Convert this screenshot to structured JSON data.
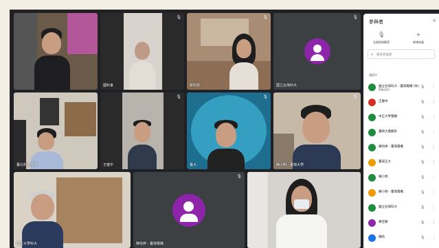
{
  "tiles": [
    {
      "name": "",
      "kind": "video"
    },
    {
      "name": "國科會",
      "kind": "video"
    },
    {
      "name": "新科技",
      "kind": "video"
    },
    {
      "name": "國立台灣科大",
      "kind": "avatar"
    },
    {
      "name": "臺北科技大學",
      "kind": "video"
    },
    {
      "name": "王健中",
      "kind": "video"
    },
    {
      "name": "臺大",
      "kind": "video"
    },
    {
      "name": "陳小明 - 臺灣大學",
      "kind": "video"
    },
    {
      "name": "國立大學科大",
      "kind": "video"
    },
    {
      "name": "陳怡婷 - 臺灣電機",
      "kind": "avatar"
    },
    {
      "name": "",
      "kind": "video"
    }
  ],
  "panel": {
    "title": "參與者",
    "close": "×",
    "actions": [
      {
        "icon": "mic-off-icon",
        "glyph": "🎙",
        "label": "全部設為靜音"
      },
      {
        "icon": "add-person-icon",
        "glyph": "+",
        "label": "新增成員"
      }
    ],
    "search_placeholder": "搜尋參與者",
    "section": "通話中",
    "participants": [
      {
        "name": "國立台灣科大 - 臺灣電機 (你)",
        "sub": "會議主辦人",
        "color": "#1e8e3e"
      },
      {
        "name": "王健中",
        "sub": "",
        "color": "#d93025"
      },
      {
        "name": "中正大學電機",
        "sub": "",
        "color": "#1e8e3e"
      },
      {
        "name": "臺師大電機系",
        "sub": "",
        "color": "#1e8e3e"
      },
      {
        "name": "陳怡婷 - 臺灣電機",
        "sub": "",
        "color": "#1e8e3e"
      },
      {
        "name": "臺灣王大",
        "sub": "",
        "color": "#f29900"
      },
      {
        "name": "陳小明",
        "sub": "",
        "color": "#1e8e3e"
      },
      {
        "name": "陳小明 - 臺灣電機",
        "sub": "",
        "color": "#f29900"
      },
      {
        "name": "國立台灣科大",
        "sub": "",
        "color": "#1e8e3e"
      },
      {
        "name": "陳佳穎",
        "sub": "",
        "color": "#8e24aa"
      },
      {
        "name": "陳怡",
        "sub": "",
        "color": "#1a73e8"
      }
    ]
  }
}
